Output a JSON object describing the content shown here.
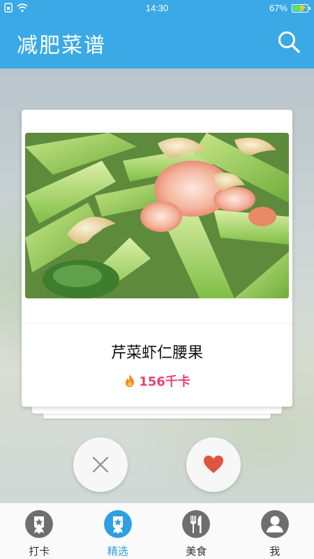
{
  "status_bar": {
    "time": "14:30",
    "battery": "67%",
    "icons": [
      "sim-icon",
      "wifi-icon",
      "battery-charging-icon"
    ]
  },
  "app_bar": {
    "title": "减肥菜谱",
    "search_icon": "search-icon"
  },
  "card": {
    "dish_name": "芹菜虾仁腰果",
    "calories": "156千卡",
    "calorie_icon": "fire-icon",
    "image": "celery-shrimp-cashew-dish-photo"
  },
  "actions": {
    "dislike_icon": "close-icon",
    "like_icon": "heart-icon"
  },
  "bottom_nav": {
    "items": [
      {
        "label": "打卡",
        "icon": "badge-star-icon",
        "active": false
      },
      {
        "label": "精选",
        "icon": "badge-star-icon",
        "active": true
      },
      {
        "label": "美食",
        "icon": "fork-knife-icon",
        "active": false
      },
      {
        "label": "我",
        "icon": "person-icon",
        "active": false
      }
    ]
  },
  "colors": {
    "primary": "#3aa9e6",
    "calorie": "#e8437a",
    "like": "#e0553f",
    "inactive_nav": "#6e6e6e",
    "active_nav": "#2e9fe0"
  }
}
